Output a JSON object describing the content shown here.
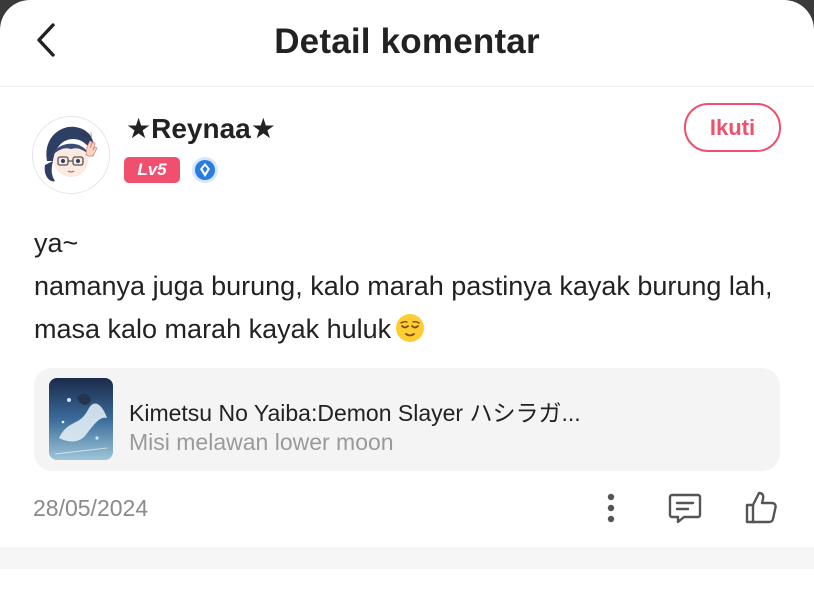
{
  "header": {
    "title": "Detail komentar"
  },
  "user": {
    "name": "★Reynaa★",
    "level": "Lv5",
    "follow_label": "Ikuti"
  },
  "comment": {
    "line1": "ya~",
    "line2": "namanya juga burung, kalo marah pastinya kayak burung lah, masa kalo marah kayak huluk",
    "emoji": "relieved-face-emoji"
  },
  "game_card": {
    "title": "Kimetsu No Yaiba:Demon Slayer ハシラガ...",
    "subtitle": "Misi melawan lower moon"
  },
  "footer": {
    "date": "28/05/2024"
  },
  "colors": {
    "accent": "#f0506e",
    "verify_blue": "#2a7ce0",
    "card_bg": "#f4f4f4",
    "muted_text": "#9a9a9a"
  },
  "icons": {
    "back": "chevron-left-icon",
    "verify": "verified-badge-icon",
    "more": "more-vertical-icon",
    "reply": "comment-icon",
    "like": "thumbs-up-icon"
  }
}
